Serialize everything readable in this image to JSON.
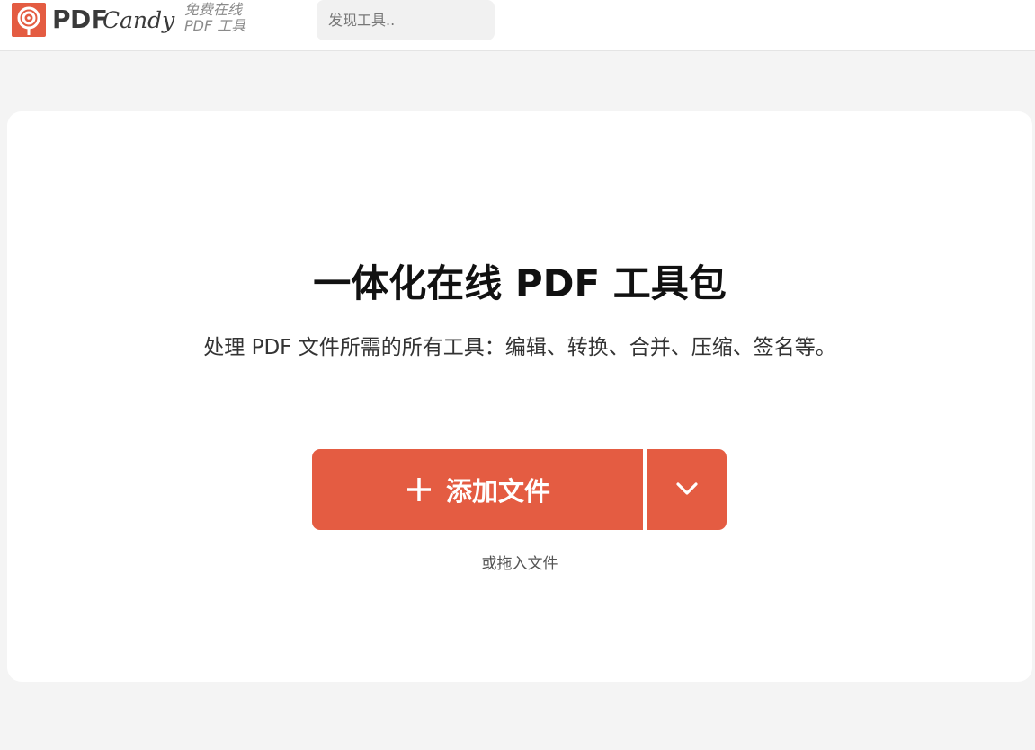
{
  "header": {
    "logo": {
      "brand_bold": "PDF",
      "brand_script": "Candy",
      "tagline_line1": "免费在线",
      "tagline_line2": "PDF 工具"
    },
    "search": {
      "placeholder": "发现工具.."
    }
  },
  "hero": {
    "title": "一体化在线 PDF 工具包",
    "subtitle": "处理 PDF 文件所需的所有工具：编辑、转换、合并、压缩、签名等。",
    "add_button_label": "添加文件",
    "add_button_icon": "plus-icon",
    "dropdown_icon": "chevron-down-icon",
    "drag_hint": "或拖入文件"
  },
  "colors": {
    "accent": "#e45c42",
    "page_background": "#f4f4f4",
    "card_background": "#ffffff"
  }
}
